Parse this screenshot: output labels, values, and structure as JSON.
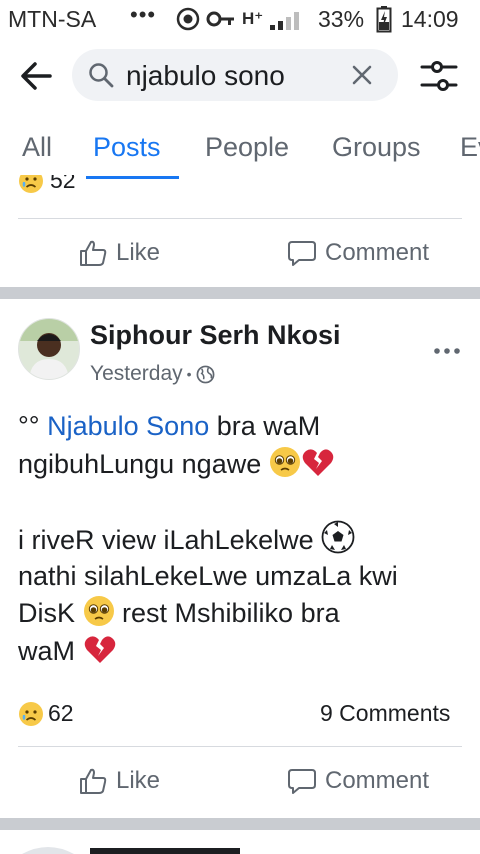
{
  "status_bar": {
    "carrier": "MTN-SA",
    "dots": "•••",
    "network": "H⁺",
    "battery": "33%",
    "time": "14:09"
  },
  "search": {
    "query": "njabulo sono"
  },
  "tabs": [
    {
      "label": "All"
    },
    {
      "label": "Posts"
    },
    {
      "label": "People"
    },
    {
      "label": "Groups"
    },
    {
      "label": "Ev"
    }
  ],
  "prev_post": {
    "reaction_count": "52",
    "like_label": "Like",
    "comment_label": "Comment"
  },
  "post": {
    "author": "Siphour Serh Nkosi",
    "time": "Yesterday",
    "meta_sep": "•",
    "lines": {
      "l1_prefix": "°° ",
      "l1_mention": "Njabulo Sono",
      "l1_suffix": " bra waM",
      "l2": "ngibuhLungu ngawe ",
      "l3": "i riveR view iLahLekelwe ",
      "l4": "nathi silahLekeLwe umzaLa kwi",
      "l5": "DisK ",
      "l5_suffix": " rest Mshibiliko bra",
      "l6": "waM "
    },
    "reaction_count": "62",
    "comments": "9 Comments",
    "like_label": "Like",
    "comment_label": "Comment"
  },
  "colors": {
    "accent": "#1877f2",
    "mention": "#1a62c6",
    "separator": "#c9ccd1"
  },
  "icons": [
    "back-arrow-icon",
    "search-icon",
    "clear-icon",
    "filter-icon",
    "thumbs-up-icon",
    "comment-icon",
    "globe-icon",
    "more-icon",
    "sad-emoji-icon",
    "pleading-emoji-icon",
    "broken-heart-icon",
    "soccer-ball-icon"
  ]
}
